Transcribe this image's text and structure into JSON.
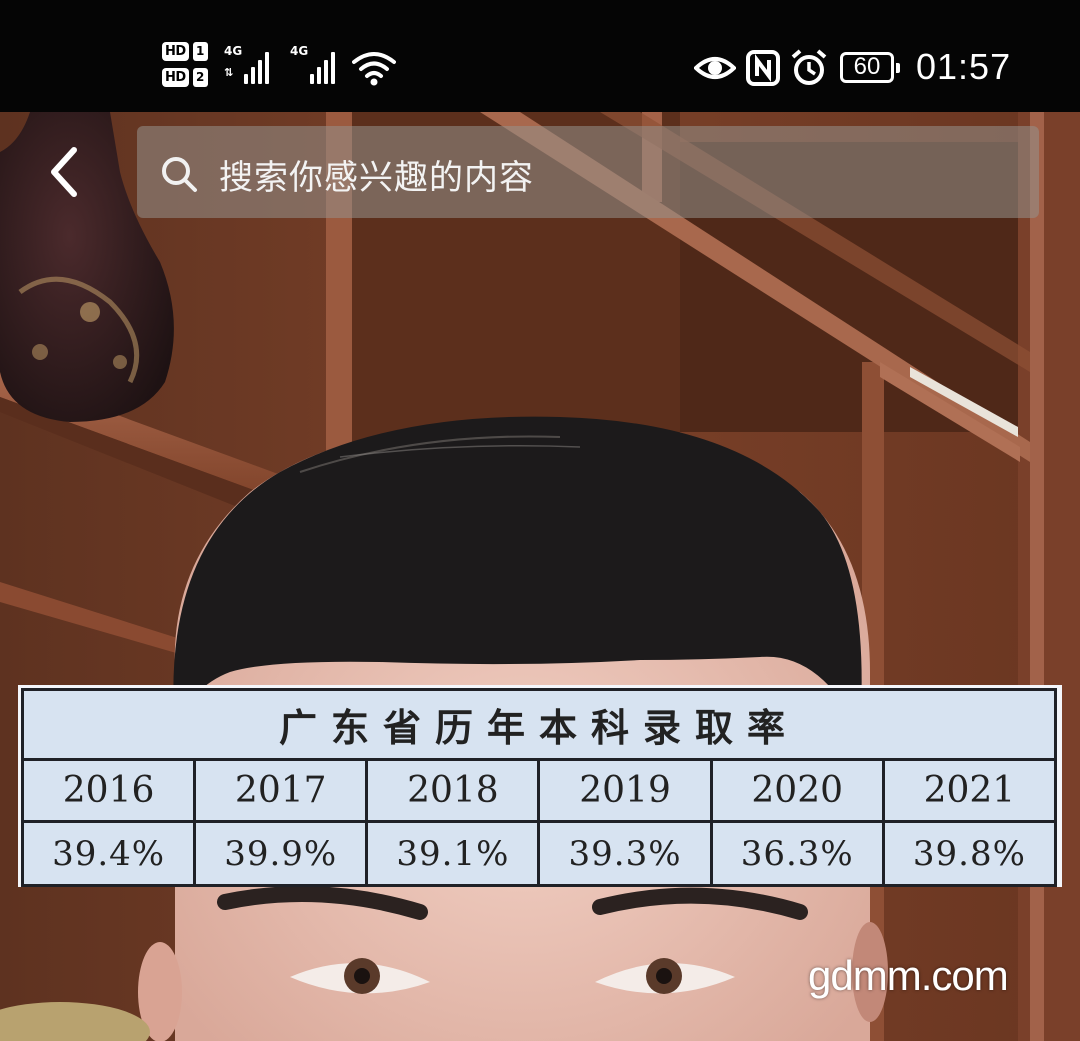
{
  "status_bar": {
    "sim1_label": "HD",
    "sim1_number": "1",
    "sim2_label": "HD",
    "sim2_number": "2",
    "network1": "4G",
    "network2": "4G",
    "battery_level": "60",
    "time": "01:57",
    "icons": [
      "eye-comfort-icon",
      "nfc-icon",
      "alarm-icon",
      "wifi-icon",
      "battery-icon"
    ]
  },
  "header": {
    "back_icon": "chevron-left-icon",
    "search_placeholder": "搜索你感兴趣的内容",
    "search_icon": "search-icon"
  },
  "table": {
    "title": "广东省历年本科录取率",
    "years": [
      "2016",
      "2017",
      "2018",
      "2019",
      "2020",
      "2021"
    ],
    "rates": [
      "39.4%",
      "39.9%",
      "39.1%",
      "39.3%",
      "36.3%",
      "39.8%"
    ]
  },
  "watermark": "gdmm.com",
  "colors": {
    "status_bar_bg": "#050505",
    "table_bg": "#d7e3f1",
    "table_border": "#1f2127",
    "wood": "#7a3f25"
  }
}
